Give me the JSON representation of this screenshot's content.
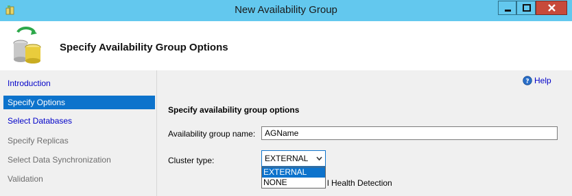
{
  "window": {
    "title": "New Availability Group"
  },
  "header": {
    "title": "Specify Availability Group Options"
  },
  "sidebar": {
    "items": [
      {
        "label": "Introduction"
      },
      {
        "label": "Specify Options"
      },
      {
        "label": "Select Databases"
      },
      {
        "label": "Specify Replicas"
      },
      {
        "label": "Select Data Synchronization"
      },
      {
        "label": "Validation"
      }
    ]
  },
  "content": {
    "help_label": "Help",
    "section_title": "Specify availability group options",
    "name_label": "Availability group name:",
    "name_value": "AGName",
    "cluster_type_label": "Cluster type:",
    "cluster_type_value": "EXTERNAL",
    "cluster_type_options": [
      "EXTERNAL",
      "NONE"
    ],
    "health_detection_label_partial": "l Health Detection"
  },
  "colors": {
    "titlebar": "#63c8ee",
    "selection": "#0d73cc",
    "link": "#0000c8",
    "close_button": "#c74a3a"
  }
}
